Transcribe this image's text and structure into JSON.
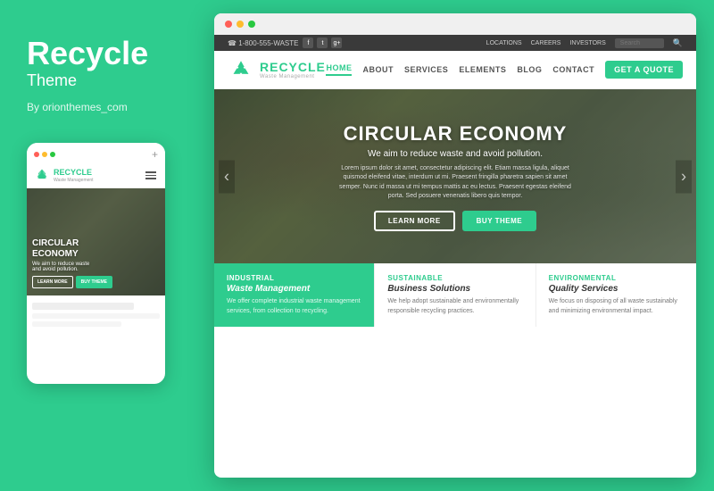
{
  "left": {
    "title": "Recycle",
    "subtitle": "Theme",
    "by": "By orionthemes_com"
  },
  "mobile": {
    "logo": "RECYCLE",
    "logo_sub": "Waste Management",
    "hero_title": "CIRCULAR\nECONOMY",
    "hero_sub": "We aim to reduce waste\nand avoid pollution.",
    "btn_learn": "LEARN MORE",
    "btn_buy": "BUY THEME"
  },
  "topbar": {
    "phone": "1-800-555-WASTE",
    "links": [
      "LOCATIONS",
      "CAREERS",
      "INVESTORS"
    ],
    "search_placeholder": "Search"
  },
  "nav": {
    "logo": "RECYCLE",
    "logo_sub": "Waste Management",
    "links": [
      "HOME",
      "ABOUT",
      "SERVICES",
      "ELEMENTS",
      "BLOG",
      "CONTACT"
    ],
    "active_link": "HOME",
    "cta": "GET A QUOTE"
  },
  "hero": {
    "title": "CIRCULAR ECONOMY",
    "subtitle": "We aim to reduce waste and avoid pollution.",
    "body": "Lorem ipsum dolor sit amet, consectetur adipiscing elit. Etiam massa ligula, aliquet\nquismod eleifend vitae, interdum ut mi. Praesent fringilla pharetra sapien sit amet\nsemper. Nunc id massa ut mi tempus mattis ac eu lectus. Praesent egestas eleifend\nporta. Sed posuere venenatis libero quis tempor.",
    "btn_learn": "LEARN MORE",
    "btn_buy": "BUY THEME"
  },
  "cards": [
    {
      "tag": "INDUSTRIAL",
      "title": "Waste Management",
      "body": "We offer complete industrial waste management services, from collection to recycling.",
      "color": "white_on_green",
      "bg": "green"
    },
    {
      "tag": "SUSTAINABLE",
      "title": "Business Solutions",
      "body": "We help adopt sustainable and environmentally responsible recycling practices.",
      "color": "green",
      "bg": "white"
    },
    {
      "tag": "ENVIRONMENTAL",
      "title": "Quality Services",
      "body": "We focus on disposing of all waste sustainably and minimizing environmental impact.",
      "color": "green",
      "bg": "white"
    }
  ]
}
